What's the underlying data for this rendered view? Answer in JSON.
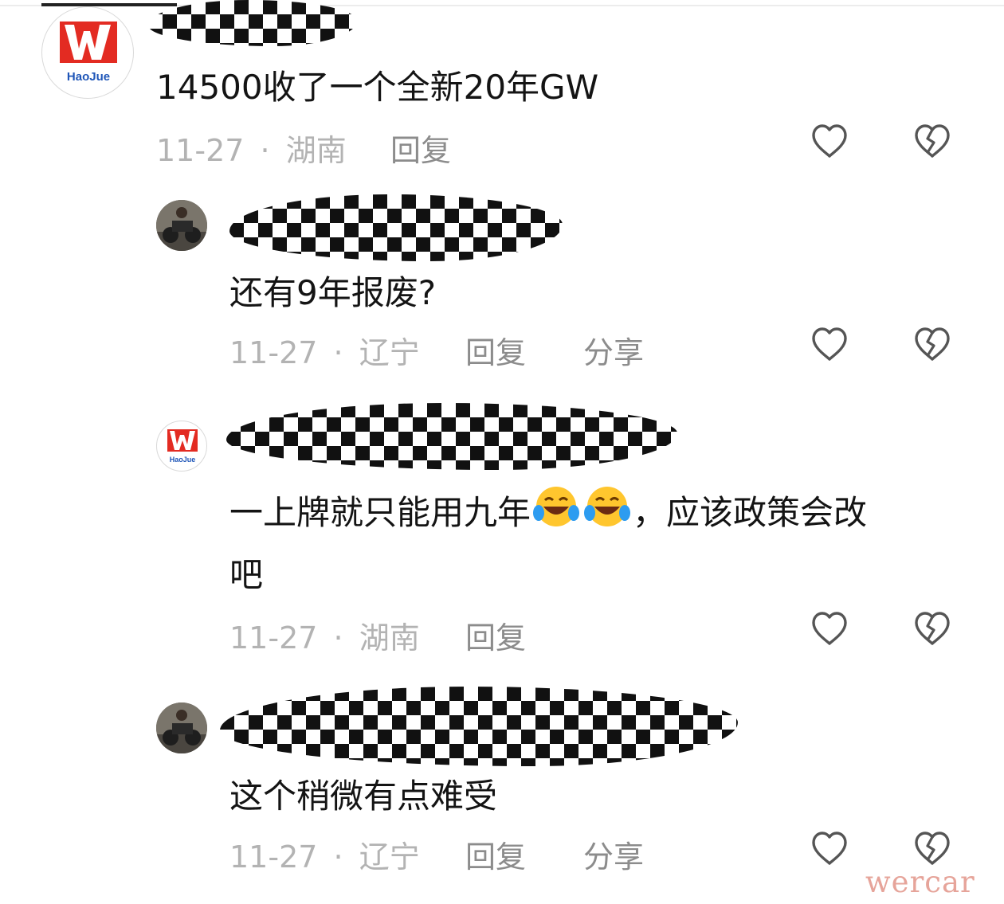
{
  "comments": [
    {
      "text": "14500收了一个全新20年GW",
      "date": "11-27",
      "region": "湖南",
      "reply_label": "回复",
      "avatar_brand": "HaoJue"
    },
    {
      "text": "还有9年报废?",
      "date": "11-27",
      "region": "辽宁",
      "reply_label": "回复",
      "share_label": "分享"
    },
    {
      "text_part1": "一上牌就只能用九年",
      "text_part2": "，应该政策会改",
      "text_line2": "吧",
      "date": "11-27",
      "region": "湖南",
      "reply_label": "回复",
      "avatar_brand": "HaoJue",
      "emoji": "rolling-on-floor-laughing"
    },
    {
      "text": "这个稍微有点难受",
      "date": "11-27",
      "region": "辽宁",
      "reply_label": "回复",
      "share_label": "分享"
    }
  ],
  "separator": "·",
  "icons": {
    "like": "heart-outline-icon",
    "dislike": "broken-heart-outline-icon"
  },
  "watermark": "wercar",
  "colors": {
    "text": "#141414",
    "meta": "#b3b3b3",
    "action": "#8c8c8c",
    "icon": "#555555",
    "brand_red": "#e32b22",
    "brand_blue": "#1f56b8",
    "watermark": "#e6a49a"
  }
}
